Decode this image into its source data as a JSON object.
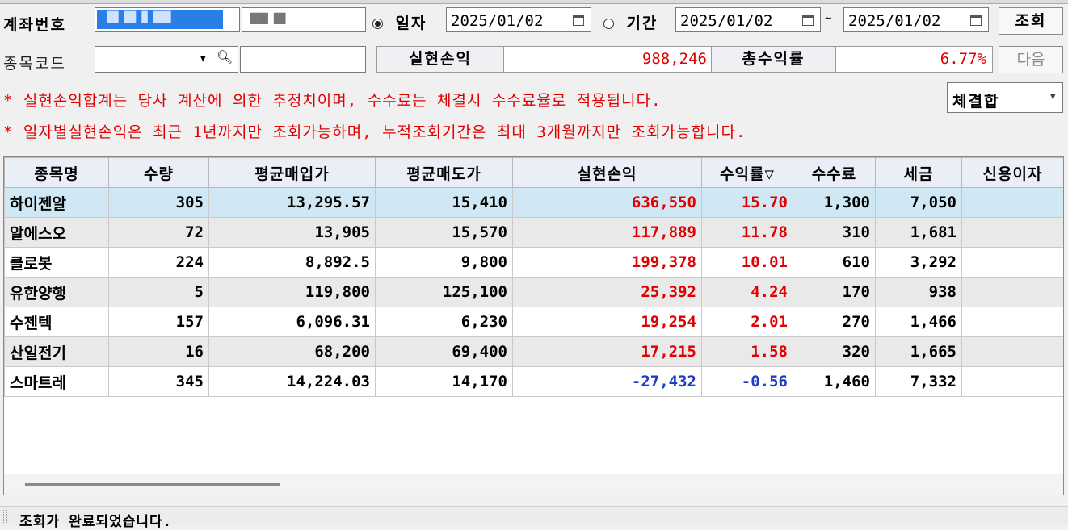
{
  "header": {
    "account_label": "계좌번호",
    "account_number": "██ ██ █ ███",
    "account_name": "███ ██",
    "radio_date": "일자",
    "date_single": "2025/01/02",
    "radio_period": "기간",
    "date_from": "2025/01/02",
    "tilde": "~",
    "date_to": "2025/01/02",
    "query_button": "조회",
    "stock_code_label": "종목코드",
    "stock_code_value": "",
    "stock_name_value": "",
    "realized_label": "실현손익",
    "realized_value": "988,246",
    "total_rate_label": "총수익률",
    "total_rate_value": "6.77%",
    "next_button": "다음",
    "notice1": "* 실현손익합계는 당사 계산에 의한 추정치이며, 수수료는 체결시 수수료율로 적용됩니다.",
    "notice2": "* 일자별실현손익은 최근 1년까지만 조회가능하며, 누적조회기간은 최대 3개월까지만 조회가능합니다.",
    "basis_select": "체결합"
  },
  "table": {
    "columns": [
      "종목명",
      "수량",
      "평균매입가",
      "평균매도가",
      "실현손익",
      "수익률▽",
      "수수료",
      "세금",
      "신용이자"
    ],
    "rows": [
      {
        "name": "하이젠알",
        "qty": "305",
        "avg_buy": "13,295.57",
        "avg_sell": "15,410",
        "profit": "636,550",
        "rate": "15.70",
        "fee": "1,300",
        "tax": "7,050",
        "interest": ""
      },
      {
        "name": "알에스오",
        "qty": "72",
        "avg_buy": "13,905",
        "avg_sell": "15,570",
        "profit": "117,889",
        "rate": "11.78",
        "fee": "310",
        "tax": "1,681",
        "interest": ""
      },
      {
        "name": "클로봇",
        "qty": "224",
        "avg_buy": "8,892.5",
        "avg_sell": "9,800",
        "profit": "199,378",
        "rate": "10.01",
        "fee": "610",
        "tax": "3,292",
        "interest": ""
      },
      {
        "name": "유한양행",
        "qty": "5",
        "avg_buy": "119,800",
        "avg_sell": "125,100",
        "profit": "25,392",
        "rate": "4.24",
        "fee": "170",
        "tax": "938",
        "interest": ""
      },
      {
        "name": "수젠텍",
        "qty": "157",
        "avg_buy": "6,096.31",
        "avg_sell": "6,230",
        "profit": "19,254",
        "rate": "2.01",
        "fee": "270",
        "tax": "1,466",
        "interest": ""
      },
      {
        "name": "산일전기",
        "qty": "16",
        "avg_buy": "68,200",
        "avg_sell": "69,400",
        "profit": "17,215",
        "rate": "1.58",
        "fee": "320",
        "tax": "1,665",
        "interest": ""
      },
      {
        "name": "스마트레",
        "qty": "345",
        "avg_buy": "14,224.03",
        "avg_sell": "14,170",
        "profit": "-27,432",
        "rate": "-0.56",
        "fee": "1,460",
        "tax": "7,332",
        "interest": ""
      }
    ]
  },
  "status": {
    "message": "조회가 완료되었습니다."
  },
  "colors": {
    "positive": "#e00000",
    "negative": "#1e3cc8",
    "selected_row": "#cfe8f3",
    "header_bg": "#eaeef6"
  }
}
